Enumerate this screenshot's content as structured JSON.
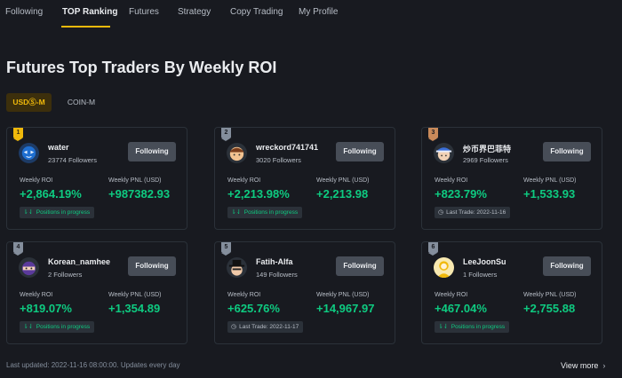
{
  "nav": {
    "tabs": [
      {
        "label": "Following",
        "active": false
      },
      {
        "label": "TOP Ranking",
        "active": true
      },
      {
        "label": "Futures",
        "active": false
      },
      {
        "label": "Strategy",
        "active": false
      },
      {
        "label": "Copy Trading",
        "active": false
      },
      {
        "label": "My Profile",
        "active": false
      }
    ]
  },
  "page_title": "Futures Top Traders By Weekly ROI",
  "segments": [
    {
      "label": "USDⓈ-M",
      "active": true
    },
    {
      "label": "COIN-M",
      "active": false
    }
  ],
  "card_labels": {
    "roi_label": "Weekly ROI",
    "pnl_label": "Weekly PNL (USD)",
    "follow_label": "Following"
  },
  "traders": [
    {
      "rank": "1",
      "medal": "gold",
      "name": "water",
      "followers": "23774 Followers",
      "roi": "+2,864.19%",
      "pnl": "+987382.93",
      "status": "Positions in progress",
      "status_type": "positions",
      "status_icon": "positions-icon",
      "avatar": "blue-mask"
    },
    {
      "rank": "2",
      "medal": "silver",
      "name": "wreckord741741",
      "followers": "3020 Followers",
      "roi": "+2,213.98%",
      "pnl": "+2,213.98",
      "status": "Positions in progress",
      "status_type": "positions",
      "status_icon": "positions-icon",
      "avatar": "orange-face"
    },
    {
      "rank": "3",
      "medal": "bronze",
      "name": "炒币界巴菲特",
      "followers": "2969 Followers",
      "roi": "+823.79%",
      "pnl": "+1,533.93",
      "status": "Last Trade: 2022-11-16",
      "status_type": "last-trade",
      "status_icon": "clock-icon",
      "avatar": "blue-hat"
    },
    {
      "rank": "4",
      "medal": "silver",
      "name": "Korean_namhee",
      "followers": "2 Followers",
      "roi": "+819.07%",
      "pnl": "+1,354.89",
      "status": "Positions in progress",
      "status_type": "positions",
      "status_icon": "positions-icon",
      "avatar": "purple-ninja"
    },
    {
      "rank": "5",
      "medal": "silver",
      "name": "Fatih-Alfa",
      "followers": "149 Followers",
      "roi": "+625.76%",
      "pnl": "+14,967.97",
      "status": "Last Trade: 2022-11-17",
      "status_type": "last-trade",
      "status_icon": "clock-icon",
      "avatar": "black-hat"
    },
    {
      "rank": "6",
      "medal": "silver",
      "name": "LeeJoonSu",
      "followers": "1 Followers",
      "roi": "+467.04%",
      "pnl": "+2,755.88",
      "status": "Positions in progress",
      "status_type": "positions",
      "status_icon": "positions-icon",
      "avatar": "yellow-person"
    }
  ],
  "footer": {
    "note": "Last updated: 2022-11-16 08:00:00. Updates every day",
    "view_more": "View more"
  },
  "colors": {
    "background": "#181a20",
    "accent": "#f0b90b",
    "positive": "#0ecb81",
    "card_border": "#2b3139",
    "button": "#474d57"
  }
}
